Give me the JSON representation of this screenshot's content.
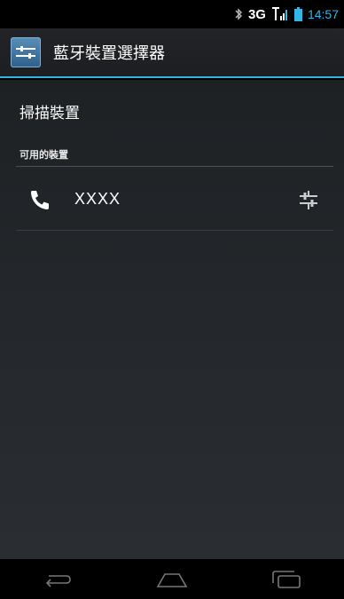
{
  "status_bar": {
    "network": "3G",
    "time": "14:57",
    "icons": [
      "bluetooth-icon",
      "signal-icon",
      "battery-icon"
    ]
  },
  "action_bar": {
    "title": "藍牙裝置選擇器",
    "icon": "bluetooth-settings-app-icon"
  },
  "scan": {
    "label": "掃描裝置"
  },
  "available": {
    "header": "可用的裝置",
    "devices": [
      {
        "name": "XXXX",
        "icon": "phone-icon",
        "action_icon": "settings-sliders-icon"
      }
    ]
  },
  "nav_bar": {
    "buttons": [
      "back-icon",
      "home-icon",
      "recents-icon"
    ]
  },
  "colors": {
    "accent": "#33b5e5",
    "background": "#1e2124"
  }
}
